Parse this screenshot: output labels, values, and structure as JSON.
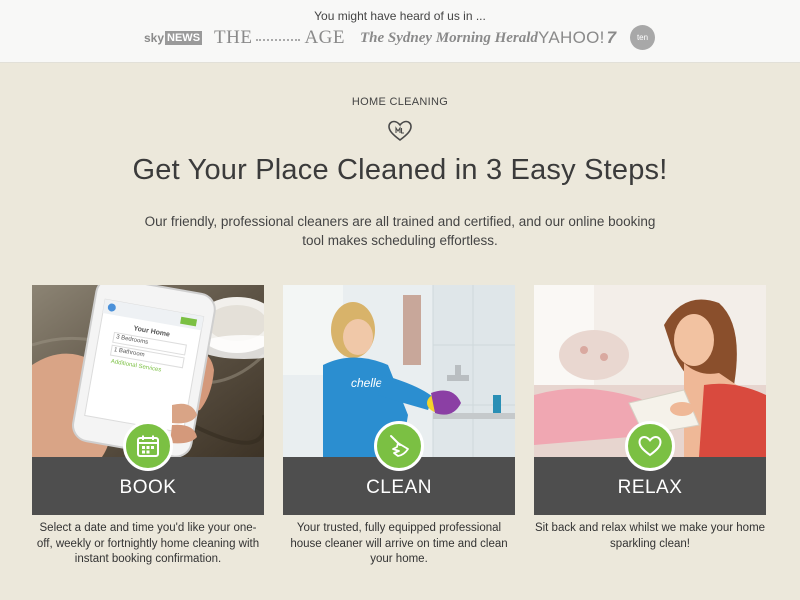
{
  "press": {
    "title": "You might have heard of us in ...",
    "logos": [
      {
        "name": "Sky News",
        "part1": "sky",
        "part2": "NEWS"
      },
      {
        "name": "The Age",
        "part1": "THE",
        "part2": "AGE"
      },
      {
        "name": "The Sydney Morning Herald",
        "text": "The Sydney Morning Herald"
      },
      {
        "name": "Yahoo!7",
        "text": "YAHOO!",
        "suffix": "7"
      },
      {
        "name": "Ten",
        "text": "ten"
      }
    ]
  },
  "main": {
    "eyebrow": "HOME CLEANING",
    "headline": "Get Your Place Cleaned in 3 Easy Steps!",
    "intro": "Our friendly, professional cleaners are all trained and certified, and our online booking tool makes scheduling effortless."
  },
  "steps": [
    {
      "label": "BOOK",
      "icon": "calendar-icon",
      "description": "Select a date and time you'd like your one-off, weekly or fortnightly home cleaning with instant booking confirmation."
    },
    {
      "label": "CLEAN",
      "icon": "broom-icon",
      "description": "Your trusted, fully equipped professional house cleaner will arrive on time and clean your home."
    },
    {
      "label": "RELAX",
      "icon": "heart-icon",
      "description": "Sit back and relax whilst we make your home sparkling clean!"
    }
  ],
  "phone_screen": {
    "heading": "Your Home",
    "options": [
      "3 Bedrooms",
      "1 Bathroom",
      "Additional Services"
    ]
  },
  "colors": {
    "background": "#ece8db",
    "accent_green": "#7bc043",
    "label_bar": "#4e4e4e"
  }
}
